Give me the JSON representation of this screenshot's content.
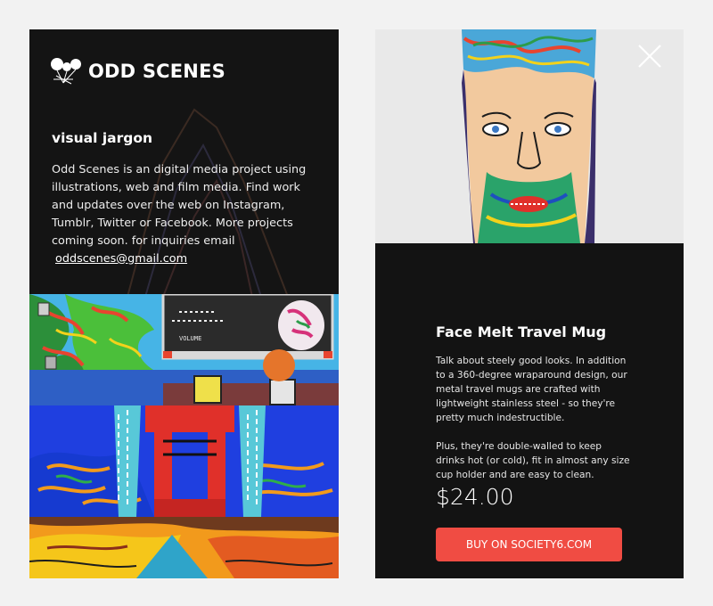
{
  "brand": {
    "name": "ODD SCENES",
    "logo_icon": "balloons-logo-icon"
  },
  "intro": {
    "tagline": "visual jargon",
    "about": "Odd Scenes is an digital media project using illustrations, web and film media. Find work and updates over the web on Instagram, Tumblr, Twitter or Facebook. More projects coming soon. for inquiries email",
    "email": "oddscenes@gmail.com"
  },
  "artwork": {
    "window_label": "VOLUME"
  },
  "product": {
    "title": "Face Melt Travel Mug",
    "description": [
      "Talk about steely good looks. In addition to a 360-degree wraparound design, our metal travel mugs are crafted with lightweight stainless steel - so they're pretty much indestructible.",
      "Plus, they're double-walled to keep drinks hot (or cold), fit in almost any size cup holder and are easy to clean."
    ],
    "price": "$24.00",
    "buy_label": "BUY ON SOCIETY6.COM"
  },
  "controls": {
    "close_icon": "close-icon"
  },
  "colors": {
    "page_bg": "#f2f2f2",
    "panel_bg": "#141414",
    "buy_button": "#f04c43",
    "art_sky": "#46b4e6",
    "art_blue": "#1f3fe0",
    "art_orange": "#f29a1c"
  }
}
